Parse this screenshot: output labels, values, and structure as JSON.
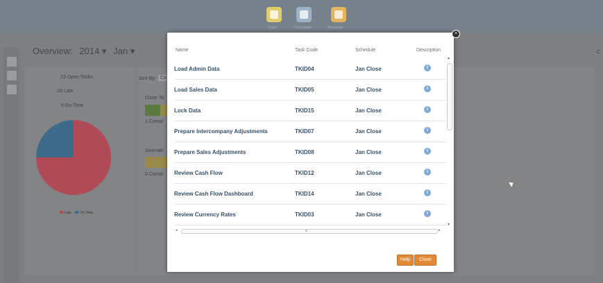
{
  "top_nav": {
    "items": [
      {
        "label": "Close",
        "icon": "document-icon",
        "color": "#e2cd6d"
      },
      {
        "label": "Consolidate",
        "icon": "people-icon",
        "color": "#9fb3c6"
      },
      {
        "label": "Financials",
        "icon": "briefcase-icon",
        "color": "#e3b35e"
      }
    ]
  },
  "overview": {
    "title": "Overview:",
    "year": "2014",
    "year_arrow": "▾",
    "period": "Jan",
    "period_arrow": "▾",
    "stats": [
      "23 Open Tasks",
      "16 Late",
      "5 On Time"
    ],
    "sort_label": "Sort By:",
    "sort_value": "Ca",
    "close_section_label": "Close Ta",
    "close_completed": "1 Compl",
    "journals_label": "Journals",
    "journals_completed": "0 Compl",
    "right_edge_text": "C",
    "legend": [
      {
        "label": "Late",
        "color": "#b04a57"
      },
      {
        "label": "On Time",
        "color": "#3f6b8a"
      }
    ]
  },
  "modal": {
    "columns": [
      "Name",
      "Task Code",
      "Schedule",
      "Description"
    ],
    "rows": [
      {
        "name": "Load Admin Data",
        "code": "TKID04",
        "schedule": "Jan Close"
      },
      {
        "name": "Load Sales Data",
        "code": "TKID05",
        "schedule": "Jan Close"
      },
      {
        "name": "Lock Data",
        "code": "TKID15",
        "schedule": "Jan Close"
      },
      {
        "name": "Prepare Intercompany Adjustments",
        "code": "TKID07",
        "schedule": "Jan Close"
      },
      {
        "name": "Prepare Sales Adjustments",
        "code": "TKID08",
        "schedule": "Jan Close"
      },
      {
        "name": "Review Cash Flow",
        "code": "TKID12",
        "schedule": "Jan Close"
      },
      {
        "name": "Review Cash Flow Dashboard",
        "code": "TKID14",
        "schedule": "Jan Close"
      },
      {
        "name": "Review Currency Rates",
        "code": "TKID03",
        "schedule": "Jan Close"
      }
    ],
    "info_glyph": "i",
    "help_button": "Help",
    "close_button": "Close",
    "close_x": "×",
    "scroll_up": "▲",
    "scroll_down": "▼",
    "scroll_left": "◂",
    "scroll_right": "▸",
    "scroll_grip": "III"
  }
}
